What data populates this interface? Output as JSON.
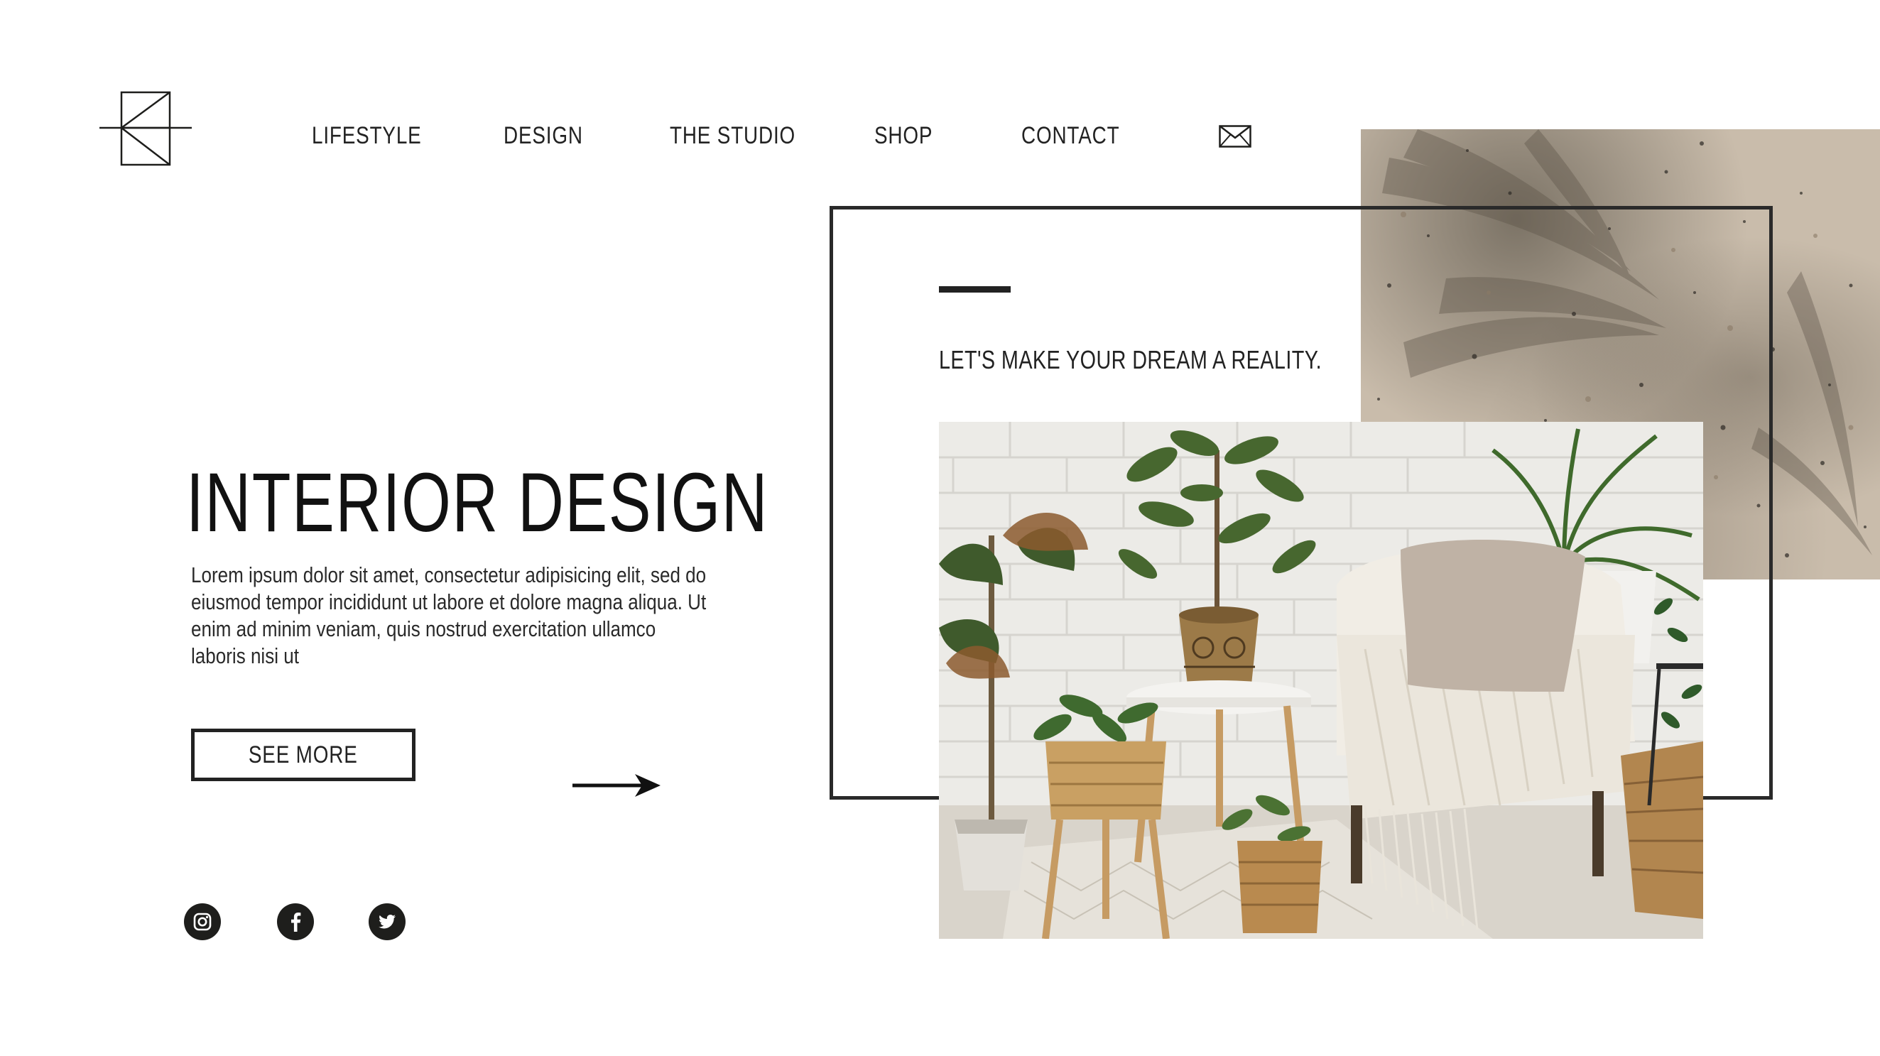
{
  "brand": {
    "logo_icon": "geometric-k-logo-icon"
  },
  "nav": {
    "items": [
      {
        "label": "LIFESTYLE"
      },
      {
        "label": "DESIGN"
      },
      {
        "label": "THE STUDIO"
      },
      {
        "label": "SHOP"
      },
      {
        "label": "CONTACT"
      }
    ],
    "mail_icon": "envelope-icon"
  },
  "hero": {
    "title": "INTERIOR DESIGN",
    "body": "Lorem ipsum dolor sit amet, consectetur adipisicing elit, sed do eiusmod tempor incididunt ut labore et dolore magna aliqua. Ut enim ad minim veniam, quis nostrud exercitation ullamco laboris nisi ut",
    "cta_label": "SEE MORE",
    "arrow_icon": "arrow-right-icon"
  },
  "social": [
    {
      "icon": "instagram-icon"
    },
    {
      "icon": "facebook-icon"
    },
    {
      "icon": "twitter-icon"
    }
  ],
  "feature": {
    "tagline": "LET'S MAKE YOUR DREAM A REALITY.",
    "photo_subject": "plants-and-armchair-photo",
    "texture": "terrazzo-stone-with-palm-shadow"
  },
  "colors": {
    "ink": "#1e1e1c",
    "background": "#ffffff",
    "stone": "#c9bcab",
    "brick": "#ecebe7"
  }
}
